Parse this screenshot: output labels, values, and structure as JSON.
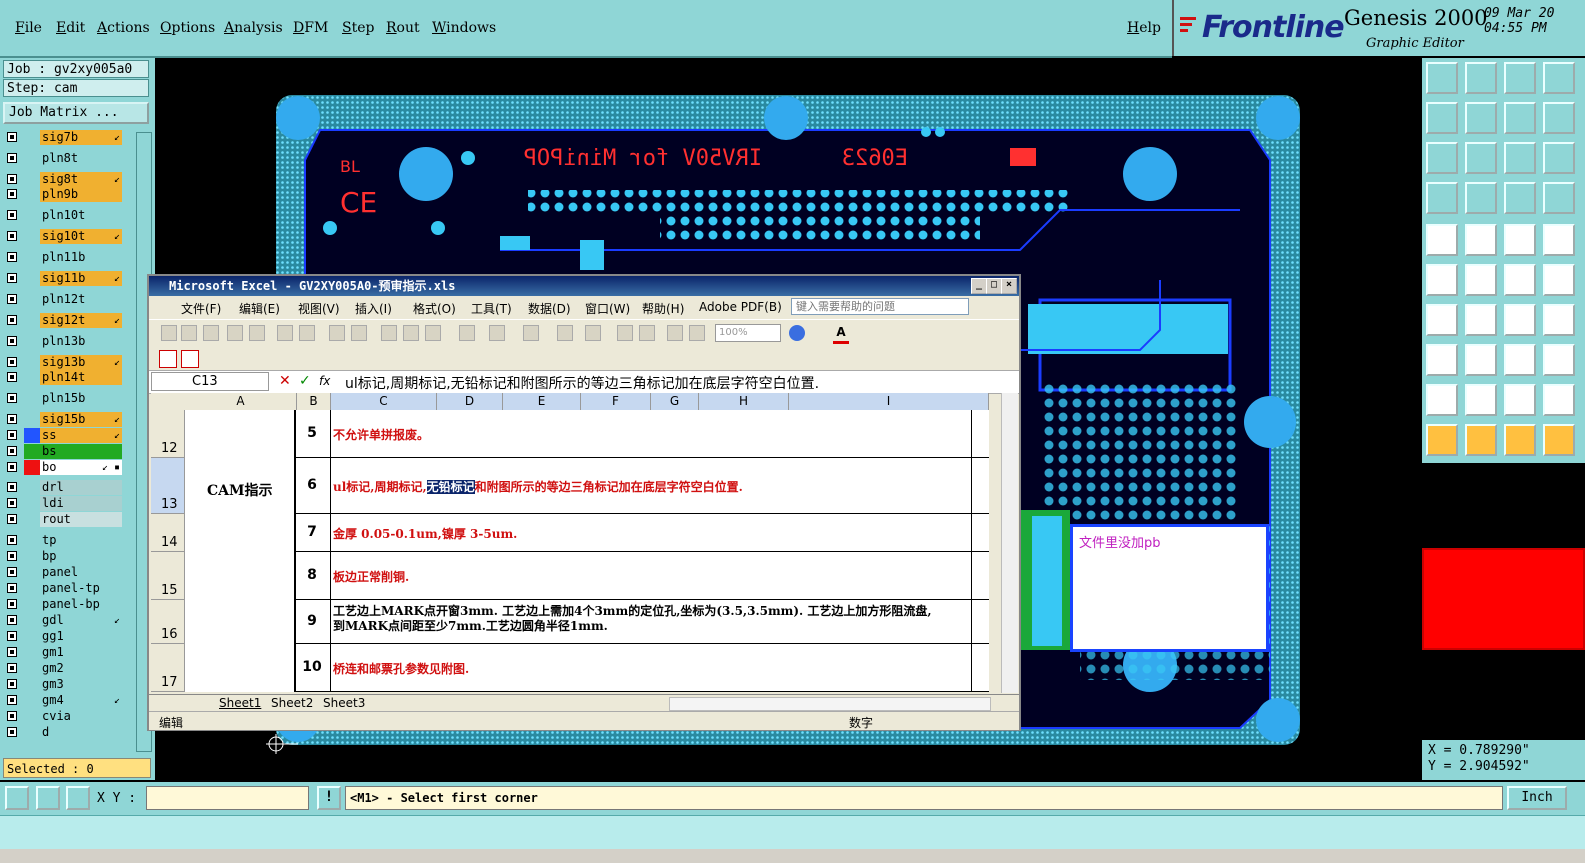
{
  "menu": {
    "items": [
      "File",
      "Edit",
      "Actions",
      "Options",
      "Analysis",
      "DFM",
      "Step",
      "Rout",
      "Windows"
    ],
    "help": "Help"
  },
  "brand": {
    "logo": "Frontline",
    "product": "Genesis 2000",
    "subtitle": "Graphic Editor",
    "date": "09 Mar 20",
    "time": "04:55 PM"
  },
  "job": {
    "job_line": "Job : gv2xy005a0",
    "step_line": "Step: cam",
    "matrix_button": "Job Matrix ..."
  },
  "layers": [
    {
      "name": "sig7b",
      "color": "#f0b030",
      "mark": "↙"
    },
    {
      "name": "pln8t",
      "color": "#8fd6d6",
      "mark": ""
    },
    {
      "name": "sig8t",
      "color": "#f0b030",
      "mark": "↙"
    },
    {
      "name": "pln9b",
      "color": "#f0b030",
      "mark": ""
    },
    {
      "name": "pln10t",
      "color": "#8fd6d6",
      "mark": ""
    },
    {
      "name": "sig10t",
      "color": "#f0b030",
      "mark": "↙"
    },
    {
      "name": "pln11b",
      "color": "#8fd6d6",
      "mark": ""
    },
    {
      "name": "sig11b",
      "color": "#f0b030",
      "mark": "↙"
    },
    {
      "name": "pln12t",
      "color": "#8fd6d6",
      "mark": ""
    },
    {
      "name": "sig12t",
      "color": "#f0b030",
      "mark": "↙"
    },
    {
      "name": "pln13b",
      "color": "#8fd6d6",
      "mark": ""
    },
    {
      "name": "sig13b",
      "color": "#f0b030",
      "mark": "↙"
    },
    {
      "name": "pln14t",
      "color": "#f0b030",
      "mark": ""
    },
    {
      "name": "pln15b",
      "color": "#8fd6d6",
      "mark": ""
    },
    {
      "name": "sig15b",
      "color": "#f0b030",
      "mark": "↙"
    },
    {
      "name": "ss",
      "color": "#f0b030",
      "mark": "↙",
      "swatch": "#2255ff"
    },
    {
      "name": "bs",
      "color": "#22aa22",
      "mark": "",
      "swatch": "#22aa22"
    },
    {
      "name": "bo",
      "color": "#ffffff",
      "mark": "↙ ▪",
      "swatch": "#ee1111"
    },
    {
      "name": "drl",
      "color": "#a8d0d0",
      "mark": ""
    },
    {
      "name": "ldi",
      "color": "#a8d0d0",
      "mark": ""
    },
    {
      "name": "rout",
      "color": "#c8e0e0",
      "mark": ""
    },
    {
      "name": "tp",
      "color": "#8fd6d6",
      "mark": ""
    },
    {
      "name": "bp",
      "color": "#8fd6d6",
      "mark": ""
    },
    {
      "name": "panel",
      "color": "#8fd6d6",
      "mark": ""
    },
    {
      "name": "panel-tp",
      "color": "#8fd6d6",
      "mark": ""
    },
    {
      "name": "panel-bp",
      "color": "#8fd6d6",
      "mark": ""
    },
    {
      "name": "gdl",
      "color": "#8fd6d6",
      "mark": "↙"
    },
    {
      "name": "gg1",
      "color": "#8fd6d6",
      "mark": ""
    },
    {
      "name": "gm1",
      "color": "#8fd6d6",
      "mark": ""
    },
    {
      "name": "gm2",
      "color": "#8fd6d6",
      "mark": ""
    },
    {
      "name": "gm3",
      "color": "#8fd6d6",
      "mark": ""
    },
    {
      "name": "gm4",
      "color": "#8fd6d6",
      "mark": "↙"
    },
    {
      "name": "cvia",
      "color": "#8fd6d6",
      "mark": ""
    },
    {
      "name": "d",
      "color": "#8fd6d6",
      "mark": ""
    }
  ],
  "selected": "Selected : 0",
  "board": {
    "silk_text": "IRV50V for MiniPOP",
    "ref_text": "E0623",
    "bl_text": "BL"
  },
  "excel": {
    "title": "Microsoft Excel - GV2XY005A0-预审指示.xls",
    "menu": [
      "文件(F)",
      "编辑(E)",
      "视图(V)",
      "插入(I)",
      "格式(O)",
      "工具(T)",
      "数据(D)",
      "窗口(W)",
      "帮助(H)",
      "Adobe PDF(B)"
    ],
    "help_placeholder": "键入需要帮助的问题",
    "zoom": "100%",
    "name_box": "C13",
    "formula": "ul标记,周期标记,无铅标记和附图所示的等边三角标记加在底层字符空白位置.",
    "columns": [
      "A",
      "B",
      "C",
      "D",
      "E",
      "F",
      "G",
      "H",
      "I"
    ],
    "cam_label": "CAM指示",
    "rows": [
      {
        "row": "12",
        "num": "5",
        "text": "不允许单拼报废。",
        "color": "#d01010"
      },
      {
        "row": "13",
        "num": "6",
        "text_pre": "ul标记,周期标记,",
        "text_hl": "无铅标记",
        "text_post": "和附图所示的等边三角标记加在底层字符空白位置.",
        "color": "#d01010"
      },
      {
        "row": "14",
        "num": "7",
        "text": "金厚 0.05-0.1um,镍厚 3-5um.",
        "color": "#d01010"
      },
      {
        "row": "15",
        "num": "8",
        "text": "板边正常削铜.",
        "color": "#d01010"
      },
      {
        "row": "16",
        "num": "9",
        "text": "工艺边上MARK点开窗3mm. 工艺边上需加4个3mm的定位孔,坐标为(3.5,3.5mm). 工艺边上加方形阻流盘,",
        "text2": "到MARK点间距至少7mm.工艺边圆角半径1mm.",
        "color": "#000000"
      },
      {
        "row": "17",
        "num": "10",
        "text": "桥连和邮票孔参数见附图.",
        "color": "#d01010"
      }
    ],
    "sheets": [
      "Sheet1",
      "Sheet2",
      "Sheet3"
    ],
    "status_left": "编辑",
    "status_mid": "数字"
  },
  "note": "文件里没加pb",
  "coords": {
    "x": "X = 0.789290\"",
    "y": "Y = 2.904592\""
  },
  "cmd": {
    "xy_label": "X Y :",
    "message": "<M1> - Select first corner",
    "units": "Inch"
  }
}
